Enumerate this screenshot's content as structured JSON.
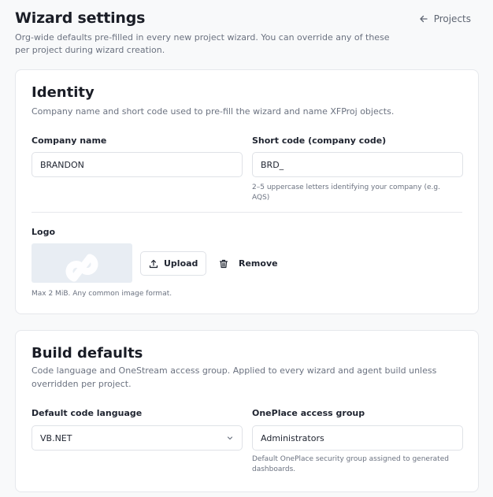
{
  "header": {
    "title": "Wizard settings",
    "subtitle": "Org-wide defaults pre-filled in every new project wizard. You can override any of these per project during wizard creation.",
    "back_link": "Projects"
  },
  "identity": {
    "title": "Identity",
    "description": "Company name and short code used to pre-fill the wizard and name XFProj objects.",
    "company_name": {
      "label": "Company name",
      "value": "BRANDON"
    },
    "short_code": {
      "label": "Short code (company code)",
      "value": "BRD_",
      "help": "2–5 uppercase letters identifying your company (e.g. AQS)"
    },
    "logo": {
      "label": "Logo",
      "upload_label": "Upload",
      "remove_label": "Remove",
      "help": "Max 2 MiB. Any common image format."
    }
  },
  "build": {
    "title": "Build defaults",
    "description": "Code language and OneStream access group. Applied to every wizard and agent build unless overridden per project.",
    "code_language": {
      "label": "Default code language",
      "value": "VB.NET"
    },
    "access_group": {
      "label": "OnePlace access group",
      "value": "Administrators",
      "help": "Default OnePlace security group assigned to generated dashboards."
    }
  },
  "icons": {
    "back": "arrow-left-icon",
    "upload": "upload-icon",
    "remove": "trash-icon",
    "select": "chevron-down-icon"
  },
  "colors": {
    "background": "#f8f9fa",
    "card": "#ffffff",
    "border": "#e6e8ec",
    "muted_text": "#6b7280"
  }
}
